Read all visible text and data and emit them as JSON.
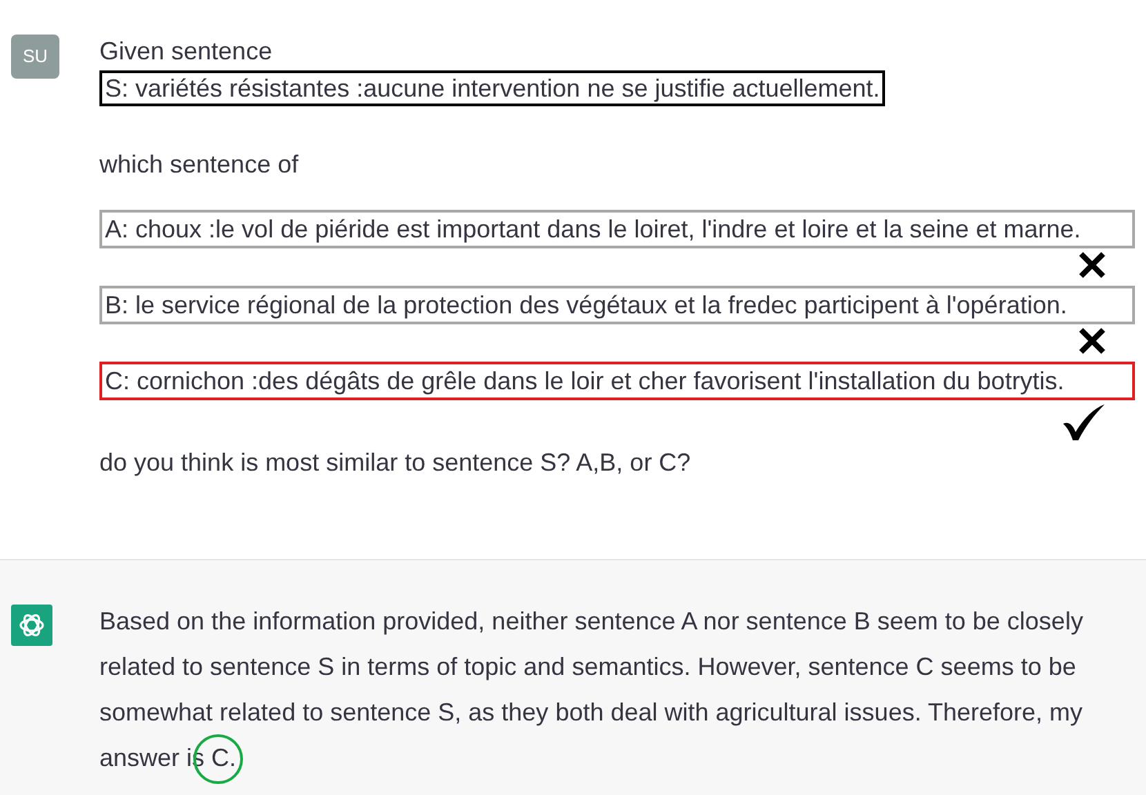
{
  "user": {
    "avatar": "SU",
    "intro": "Given sentence",
    "reference": "S: variétés résistantes :aucune intervention ne se justifie actuellement.",
    "question_start": "which sentence of",
    "options": [
      {
        "label": "A: choux :le vol de piéride est important dans le loiret, l'indre et loire et la seine et marne.",
        "correct": false
      },
      {
        "label": "B: le service régional de la protection des végétaux et la fredec participent à l'opération.",
        "correct": false
      },
      {
        "label": "C: cornichon :des dégâts de grêle dans le loir et cher favorisent l'installation du botrytis.",
        "correct": true
      }
    ],
    "question_end": "do you think is most similar to sentence S? A,B, or C?"
  },
  "assistant": {
    "text": "Based on the information provided, neither sentence A nor sentence B seem to be closely related to sentence S in terms of topic and semantics. However, sentence C seems to be somewhat related to sentence S, as they both deal with agricultural issues. Therefore, my answer is",
    "answer": "C."
  }
}
